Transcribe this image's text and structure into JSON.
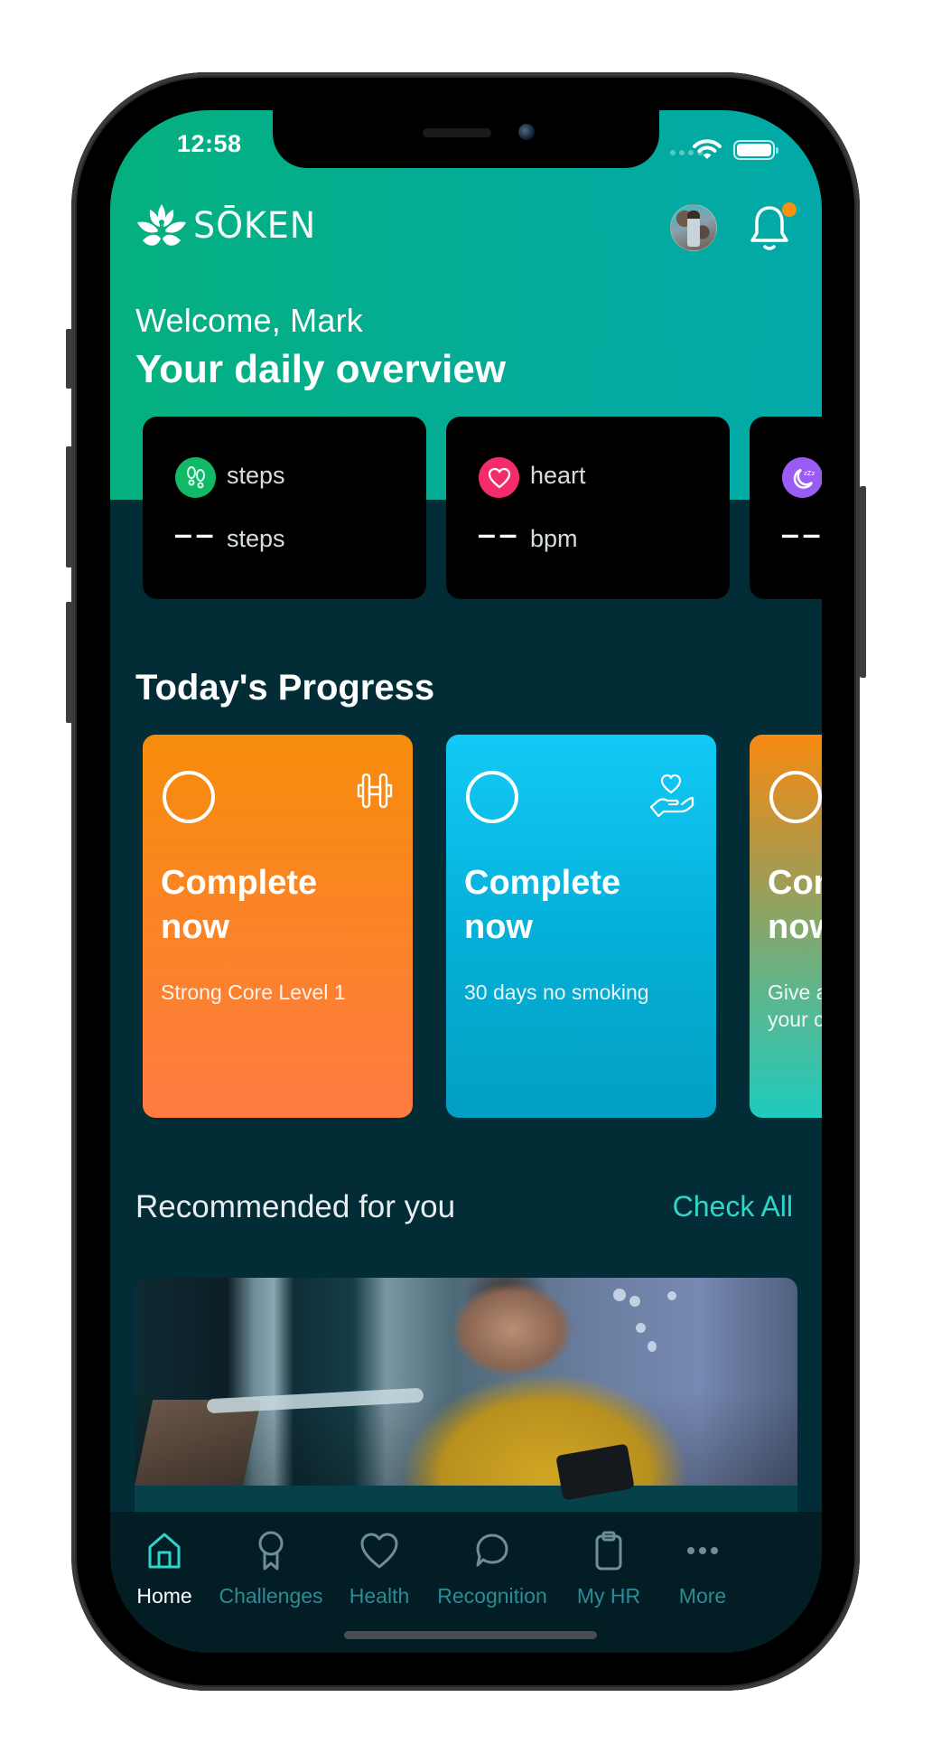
{
  "status_bar": {
    "time": "12:58"
  },
  "header": {
    "brand": "SŌKEN",
    "notification_badge_color": "#f7910e",
    "welcome": "Welcome, Mark",
    "title": "Your daily overview"
  },
  "stats": [
    {
      "icon": "footsteps-icon",
      "label": "steps",
      "value": "--",
      "unit": "steps",
      "color": "#11b866"
    },
    {
      "icon": "heart-icon",
      "label": "heart",
      "value": "--",
      "unit": "bpm",
      "color": "#f52c6b"
    },
    {
      "icon": "moon-sleep-icon",
      "label": "",
      "value": "--",
      "unit": "",
      "color": "#9a5cf5"
    }
  ],
  "progress": {
    "title": "Today's Progress",
    "cards": [
      {
        "cta": "Complete\nnow",
        "subtitle": "Strong Core Level 1",
        "icon": "dumbbell-icon",
        "completed": false
      },
      {
        "cta": "Complete\nnow",
        "subtitle": "30 days no smoking",
        "icon": "hand-heart-icon",
        "completed": false
      },
      {
        "cta": "Complete\nnow",
        "subtitle": "Give a\nyour c",
        "icon": "",
        "completed": false
      }
    ]
  },
  "recommended": {
    "title": "Recommended for you",
    "check_all": "Check All",
    "accent": "#2fd5cb"
  },
  "tabbar": {
    "active": "Home",
    "items": [
      {
        "label": "Home",
        "icon": "home-icon"
      },
      {
        "label": "Challenges",
        "icon": "award-ribbon-icon"
      },
      {
        "label": "Health",
        "icon": "heart-outline-icon"
      },
      {
        "label": "Recognition",
        "icon": "chat-bubble-icon"
      },
      {
        "label": "My HR",
        "icon": "clipboard-icon"
      },
      {
        "label": "More",
        "icon": "more-dots-icon"
      }
    ]
  }
}
